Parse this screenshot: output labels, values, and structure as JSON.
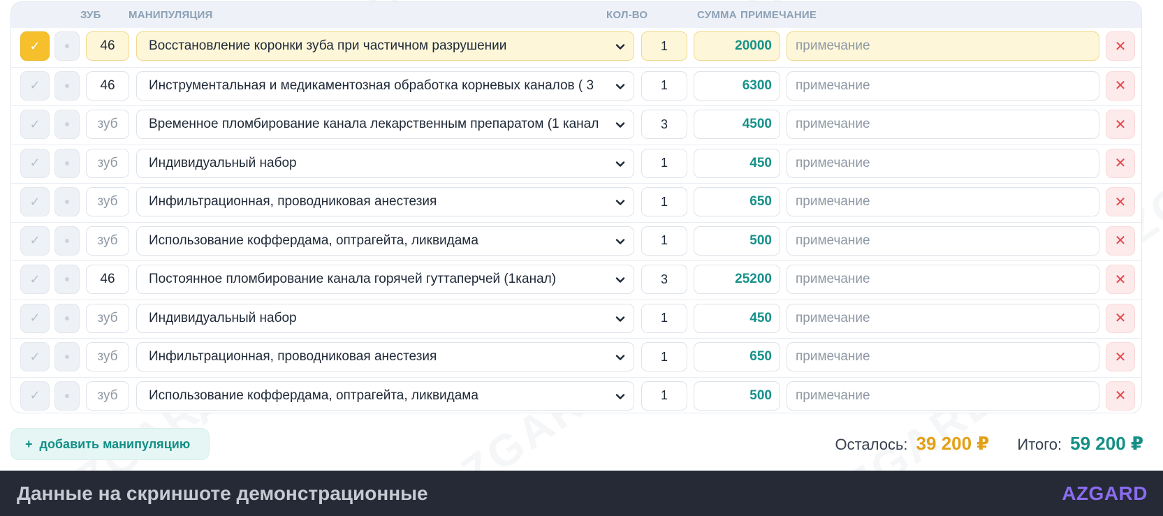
{
  "watermark": "AZGARD",
  "header": {
    "tooth": "ЗУБ",
    "manipulation": "МАНИПУЛЯЦИЯ",
    "qty": "КОЛ-ВО",
    "sum": "СУММА",
    "note": "ПРИМЕЧАНИЕ"
  },
  "rows": [
    {
      "checked": true,
      "tooth": "46",
      "manipulation": "Восстановление коронки зуба при частичном разрушении",
      "qty": "1",
      "sum": "20000",
      "note": "примечание",
      "highlighted": true
    },
    {
      "checked": false,
      "tooth": "46",
      "manipulation": "Инструментальная и медикаментозная обработка корневых каналов ( 3",
      "qty": "1",
      "sum": "6300",
      "note": "примечание",
      "highlighted": false
    },
    {
      "checked": false,
      "tooth": "зуб",
      "manipulation": "Временное пломбирование канала лекарственным препаратом (1 канал",
      "qty": "3",
      "sum": "4500",
      "note": "примечание",
      "highlighted": false
    },
    {
      "checked": false,
      "tooth": "зуб",
      "manipulation": "Индивидуальный набор",
      "qty": "1",
      "sum": "450",
      "note": "примечание",
      "highlighted": false
    },
    {
      "checked": false,
      "tooth": "зуб",
      "manipulation": "Инфильтрационная, проводниковая анестезия",
      "qty": "1",
      "sum": "650",
      "note": "примечание",
      "highlighted": false
    },
    {
      "checked": false,
      "tooth": "зуб",
      "manipulation": "Использование коффердама, оптрагейта, ликвидама",
      "qty": "1",
      "sum": "500",
      "note": "примечание",
      "highlighted": false
    },
    {
      "checked": false,
      "tooth": "46",
      "manipulation": "Постоянное пломбирование канала горячей гуттаперчей (1канал)",
      "qty": "3",
      "sum": "25200",
      "note": "примечание",
      "highlighted": false
    },
    {
      "checked": false,
      "tooth": "зуб",
      "manipulation": "Индивидуальный набор",
      "qty": "1",
      "sum": "450",
      "note": "примечание",
      "highlighted": false
    },
    {
      "checked": false,
      "tooth": "зуб",
      "manipulation": "Инфильтрационная, проводниковая анестезия",
      "qty": "1",
      "sum": "650",
      "note": "примечание",
      "highlighted": false
    },
    {
      "checked": false,
      "tooth": "зуб",
      "manipulation": "Использование коффердама, оптрагейта, ликвидама",
      "qty": "1",
      "sum": "500",
      "note": "примечание",
      "highlighted": false
    }
  ],
  "icons": {
    "check": "check-icon",
    "dot": "dot-icon",
    "chevron": "chevron-down-icon",
    "delete": "close-icon",
    "add": "plus-icon"
  },
  "add_button": {
    "icon": "+",
    "label": "добавить манипуляцию"
  },
  "totals": {
    "remaining_label": "Осталось:",
    "remaining_value": "39 200 ₽",
    "total_label": "Итого:",
    "total_value": "59 200 ₽"
  },
  "footer": {
    "text": "Данные на скриншоте демонстрационные",
    "logo": "AZGARD"
  },
  "colors": {
    "accent_yellow": "#f5c02c",
    "accent_teal": "#148f86",
    "sum_teal": "#17918a",
    "remaining_orange": "#e3a017",
    "delete_red": "#e5484d",
    "footer_bg": "#252a36",
    "logo_purple": "#8b6cf0"
  }
}
